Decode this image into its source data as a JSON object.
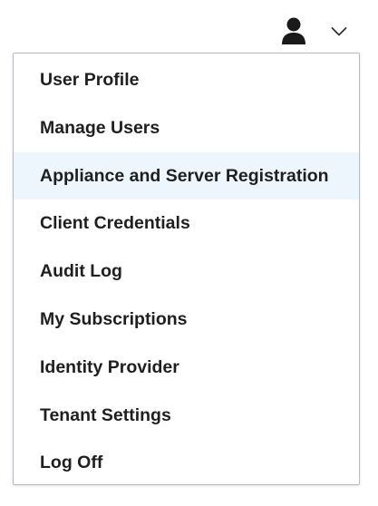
{
  "header": {
    "user_icon": "user-silhouette-icon",
    "chevron_icon": "chevron-down-icon"
  },
  "menu": {
    "highlight_color": "#eef6fd",
    "items": [
      {
        "label": "User Profile"
      },
      {
        "label": "Manage Users"
      },
      {
        "label": "Appliance and Server Registration",
        "highlighted": true
      },
      {
        "label": "Client Credentials"
      },
      {
        "label": "Audit Log"
      },
      {
        "label": "My Subscriptions"
      },
      {
        "label": "Identity Provider"
      },
      {
        "label": "Tenant Settings"
      },
      {
        "label": "Log Off"
      }
    ]
  }
}
